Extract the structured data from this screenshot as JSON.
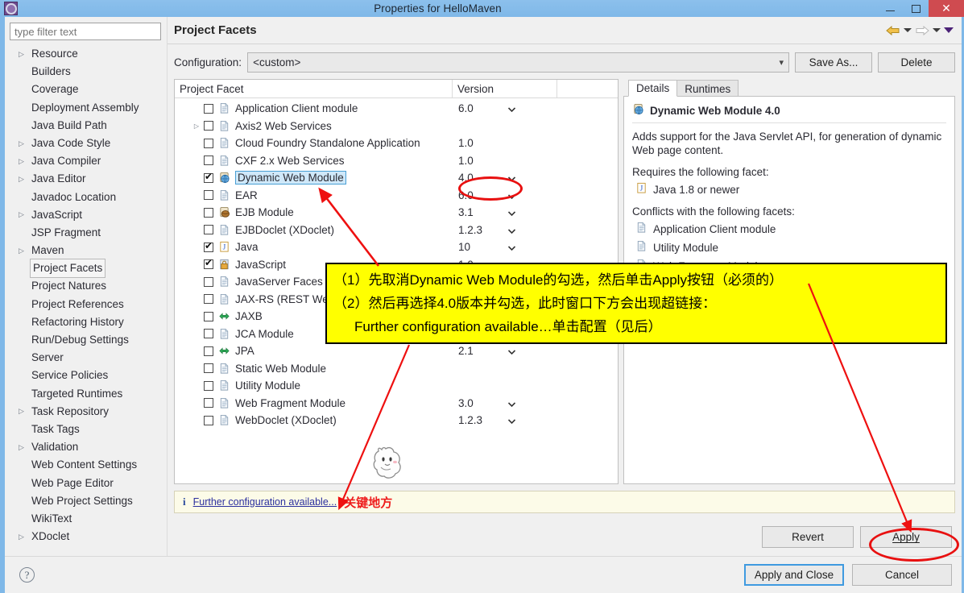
{
  "window": {
    "title": "Properties for HelloMaven",
    "minimize_label": "Minimize",
    "maximize_label": "Maximize",
    "close_label": "✕"
  },
  "sidebar": {
    "filter_placeholder": "type filter text",
    "filter_value": "",
    "items": [
      {
        "label": "Resource",
        "expandable": true,
        "selected": false
      },
      {
        "label": "Builders",
        "expandable": false,
        "selected": false
      },
      {
        "label": "Coverage",
        "expandable": false,
        "selected": false
      },
      {
        "label": "Deployment Assembly",
        "expandable": false,
        "selected": false
      },
      {
        "label": "Java Build Path",
        "expandable": false,
        "selected": false
      },
      {
        "label": "Java Code Style",
        "expandable": true,
        "selected": false
      },
      {
        "label": "Java Compiler",
        "expandable": true,
        "selected": false
      },
      {
        "label": "Java Editor",
        "expandable": true,
        "selected": false
      },
      {
        "label": "Javadoc Location",
        "expandable": false,
        "selected": false
      },
      {
        "label": "JavaScript",
        "expandable": true,
        "selected": false
      },
      {
        "label": "JSP Fragment",
        "expandable": false,
        "selected": false
      },
      {
        "label": "Maven",
        "expandable": true,
        "selected": false
      },
      {
        "label": "Project Facets",
        "expandable": false,
        "selected": true
      },
      {
        "label": "Project Natures",
        "expandable": false,
        "selected": false
      },
      {
        "label": "Project References",
        "expandable": false,
        "selected": false
      },
      {
        "label": "Refactoring History",
        "expandable": false,
        "selected": false
      },
      {
        "label": "Run/Debug Settings",
        "expandable": false,
        "selected": false
      },
      {
        "label": "Server",
        "expandable": false,
        "selected": false
      },
      {
        "label": "Service Policies",
        "expandable": false,
        "selected": false
      },
      {
        "label": "Targeted Runtimes",
        "expandable": false,
        "selected": false
      },
      {
        "label": "Task Repository",
        "expandable": true,
        "selected": false
      },
      {
        "label": "Task Tags",
        "expandable": false,
        "selected": false
      },
      {
        "label": "Validation",
        "expandable": true,
        "selected": false
      },
      {
        "label": "Web Content Settings",
        "expandable": false,
        "selected": false
      },
      {
        "label": "Web Page Editor",
        "expandable": false,
        "selected": false
      },
      {
        "label": "Web Project Settings",
        "expandable": false,
        "selected": false
      },
      {
        "label": "WikiText",
        "expandable": false,
        "selected": false
      },
      {
        "label": "XDoclet",
        "expandable": true,
        "selected": false
      }
    ]
  },
  "page": {
    "title": "Project Facets"
  },
  "config": {
    "label": "Configuration:",
    "value": "<custom>",
    "save_as_label": "Save As...",
    "delete_label": "Delete"
  },
  "facets_table": {
    "columns": [
      "Project Facet",
      "Version",
      ""
    ],
    "rows": [
      {
        "name": "Application Client module",
        "version": "6.0",
        "checked": false,
        "expandable": false,
        "dropdown": true,
        "icon": "document-icon",
        "selected": false
      },
      {
        "name": "Axis2 Web Services",
        "version": "",
        "checked": false,
        "expandable": true,
        "dropdown": false,
        "icon": "document-icon",
        "selected": false
      },
      {
        "name": "Cloud Foundry Standalone Application",
        "version": "1.0",
        "checked": false,
        "expandable": false,
        "dropdown": false,
        "icon": "document-icon",
        "selected": false
      },
      {
        "name": "CXF 2.x Web Services",
        "version": "1.0",
        "checked": false,
        "expandable": false,
        "dropdown": false,
        "icon": "document-icon",
        "selected": false
      },
      {
        "name": "Dynamic Web Module",
        "version": "4.0",
        "checked": true,
        "expandable": false,
        "dropdown": true,
        "icon": "web-module-icon",
        "selected": true
      },
      {
        "name": "EAR",
        "version": "6.0",
        "checked": false,
        "expandable": false,
        "dropdown": true,
        "icon": "document-icon",
        "selected": false
      },
      {
        "name": "EJB Module",
        "version": "3.1",
        "checked": false,
        "expandable": false,
        "dropdown": true,
        "icon": "ejb-icon",
        "selected": false
      },
      {
        "name": "EJBDoclet (XDoclet)",
        "version": "1.2.3",
        "checked": false,
        "expandable": false,
        "dropdown": true,
        "icon": "document-icon",
        "selected": false
      },
      {
        "name": "Java",
        "version": "10",
        "checked": true,
        "expandable": false,
        "dropdown": true,
        "icon": "java-icon",
        "selected": false
      },
      {
        "name": "JavaScript",
        "version": "1.0",
        "checked": true,
        "expandable": false,
        "dropdown": false,
        "icon": "javascript-icon",
        "selected": false
      },
      {
        "name": "JavaServer Faces",
        "version": "",
        "checked": false,
        "expandable": false,
        "dropdown": false,
        "icon": "document-icon",
        "selected": false
      },
      {
        "name": "JAX-RS (REST Web Services)",
        "version": "",
        "checked": false,
        "expandable": false,
        "dropdown": false,
        "icon": "document-icon",
        "selected": false
      },
      {
        "name": "JAXB",
        "version": "",
        "checked": false,
        "expandable": false,
        "dropdown": false,
        "icon": "jaxb-icon",
        "selected": false
      },
      {
        "name": "JCA Module",
        "version": "",
        "checked": false,
        "expandable": false,
        "dropdown": false,
        "icon": "document-icon",
        "selected": false
      },
      {
        "name": "JPA",
        "version": "2.1",
        "checked": false,
        "expandable": false,
        "dropdown": true,
        "icon": "jaxb-icon",
        "selected": false
      },
      {
        "name": "Static Web Module",
        "version": "",
        "checked": false,
        "expandable": false,
        "dropdown": false,
        "icon": "document-icon",
        "selected": false
      },
      {
        "name": "Utility Module",
        "version": "",
        "checked": false,
        "expandable": false,
        "dropdown": false,
        "icon": "document-icon",
        "selected": false
      },
      {
        "name": "Web Fragment Module",
        "version": "3.0",
        "checked": false,
        "expandable": false,
        "dropdown": true,
        "icon": "document-icon",
        "selected": false
      },
      {
        "name": "WebDoclet (XDoclet)",
        "version": "1.2.3",
        "checked": false,
        "expandable": false,
        "dropdown": true,
        "icon": "document-icon",
        "selected": false
      }
    ]
  },
  "details": {
    "tabs": [
      {
        "label": "Details",
        "active": true
      },
      {
        "label": "Runtimes",
        "active": false
      }
    ],
    "facet_title": "Dynamic Web Module 4.0",
    "description": "Adds support for the Java Servlet API, for generation of dynamic Web page content.",
    "requires_label": "Requires the following facet:",
    "requires": [
      "Java 1.8 or newer"
    ],
    "conflicts_label": "Conflicts with the following facets:",
    "conflicts": [
      "Application Client module",
      "Utility Module",
      "Web Fragment Module"
    ]
  },
  "status": {
    "icon": "info-icon",
    "link": "Further configuration available...",
    "note": "关键地方"
  },
  "footer": {
    "revert_label": "Revert",
    "apply_label": "Apply",
    "apply_and_close_label": "Apply and Close",
    "cancel_label": "Cancel",
    "help_label": "?"
  },
  "annotation": {
    "line1": "（1）先取消Dynamic Web Module的勾选，然后单击Apply按钮（必须的）",
    "line2": "（2）然后再选择4.0版本并勾选，此时窗口下方会出现超链接：",
    "line3": "Further configuration available…单击配置（见后）",
    "accent_color": "#ee1010",
    "highlight_color": "#ffff00"
  }
}
